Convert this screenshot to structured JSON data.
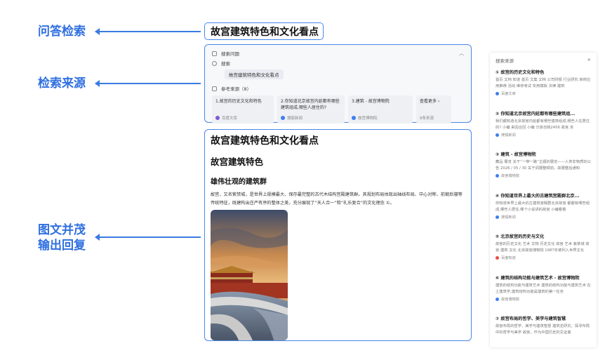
{
  "callouts": {
    "qa_search": "问答检索",
    "search_source": "检索来源",
    "image_text": [
      "图文并茂",
      "输出回复"
    ]
  },
  "query_box": {
    "text": "故宫建筑特色和文化看点"
  },
  "search_panel": {
    "header": "搜索问题",
    "search_label": "搜索",
    "query": "故宫建筑特色和文化看点",
    "sources_label": "参考来源（8）",
    "cards": [
      {
        "title": "1.故宫的历史文化和特色",
        "source": "百度文库"
      },
      {
        "title": "2.你知道北京故宫内延都有哪些建筑组成,哪些人居住的?",
        "source": "搜狐新闻"
      },
      {
        "title": "3.建筑 - 故宫博物院",
        "source": "故宫博物院"
      },
      {
        "title": "查看更多",
        "source": "8条来源"
      }
    ]
  },
  "answer": {
    "title": "故宫建筑特色和文化看点",
    "h2": "故宫建筑特色",
    "h3": "雄伟壮观的建筑群",
    "paragraph": "故宫，又名紫禁城，是世界上规模最大、保存最完整的古代木结构宫殿建筑群。其规划布局体现出轴线布局、中心对称、前朝后寝等传统特征，既建构出庄严有序的整体之美，充分展现了“天人合一”和“礼乐复合”的文化理念 ①。"
  },
  "sidebar": {
    "title": "搜索来源",
    "close_glyph": "×",
    "items": [
      {
        "title": "① 故宫的历史文化和特色",
        "desc": "首页 文档 知道 首页 文集 文档 公司财报 行业研究 高校应用推荐 活动 维修考试 实用模板 法律 建筑",
        "source": "百度文库",
        "color": "#3d7ff0"
      },
      {
        "title": "② 你知道北京故宫内延都有哪些建筑组...",
        "desc": "我们都知道北京故宫内延都有哪些建筑组成,哪些人在居住的? 小编 来回合回 小编 分享自我2456 故宫 京",
        "source": "搜狐新闻",
        "color": "#3d7ff0"
      },
      {
        "title": "③ 建筑 - 故宫博物院",
        "desc": "藏品 展览 关于“一带一路”主题的展览——人类非物质的公告 2026 / 05 / 30 关于调展整顿前，故展整后通知",
        "source": "故宫博物院",
        "color": "#3d7ff0"
      },
      {
        "title": "④ 你知道世界上最大的古建筑宫殿群北京...",
        "desc": "你知道世界上最大的古建筑宫殿群北京故宫 都都有哪些组成,哪些人居住,哪个小说讲的故宫 小编看看",
        "source": "搜狐新闻",
        "color": "#3d7ff0"
      },
      {
        "title": "⑤ 北京故宫的历史与文化",
        "desc": "故宫的历史文化 艺术 文物 历史文化 故宫 艺术 紫禁城 故宫 建筑 文化 北京故宫博物院 1987年被列入世界文化",
        "source": "百度知道",
        "color": "#e7503c"
      },
      {
        "title": "⑥ 建筑的结构功能与建筑艺术 - 故宫博物院",
        "desc": "建筑的结构功能与建筑艺术 建筑的结构功能与建筑艺术 在土建筑学,建筑结构功能是建筑的第一任务",
        "source": "故宫博物院",
        "color": "#3d7ff0"
      },
      {
        "title": "⑦ 故宫布局的哲学、美学与建筑智慧",
        "desc": "故宫布局的哲学、美学与建筑智慧 建筑史研究，探寻布局中的哲学与美学 故宫，作为中国历史的见证者",
        "source": "",
        "color": "#3d7ff0"
      }
    ]
  },
  "colors": {
    "accent": "#4b86e8",
    "callout": "#2f6fe0"
  }
}
